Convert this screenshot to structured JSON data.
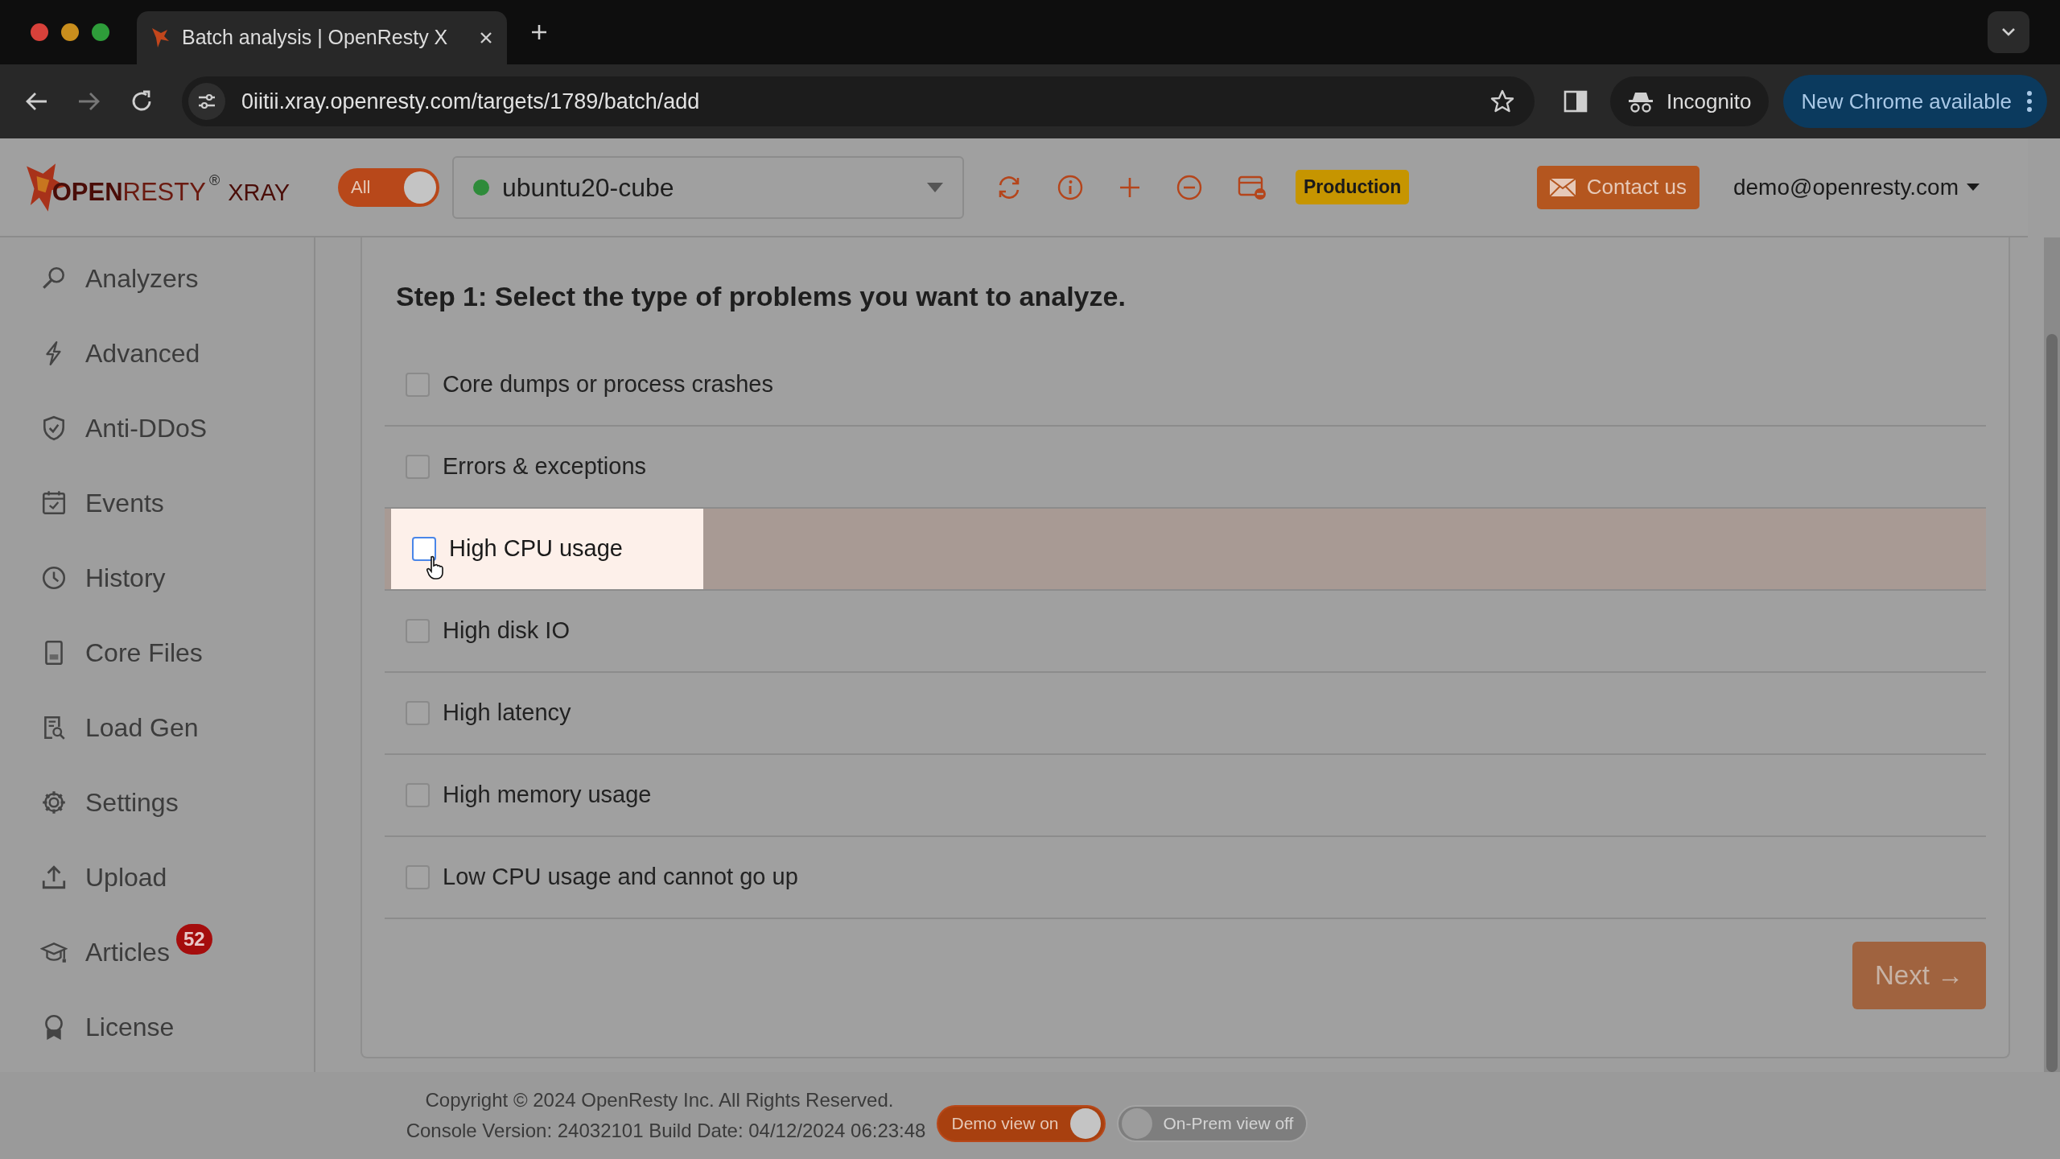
{
  "browser": {
    "tab_title": "Batch analysis | OpenResty X",
    "url": "0iitii.xray.openresty.com/targets/1789/batch/add",
    "incognito": "Incognito",
    "update": "New Chrome available"
  },
  "header": {
    "logo": {
      "brand_a": "OPEN",
      "brand_b": "RESTY",
      "mark": "®",
      "product": "XRAY"
    },
    "all_toggle": {
      "label": "All",
      "on": true
    },
    "target": {
      "value": "ubuntu20-cube",
      "color": "#2e8b3a"
    },
    "env_badge": "Production",
    "contact": "Contact us",
    "user": "demo@openresty.com"
  },
  "sidebar": {
    "items": [
      {
        "label": "Analyzers"
      },
      {
        "label": "Advanced"
      },
      {
        "label": "Anti-DDoS"
      },
      {
        "label": "Events"
      },
      {
        "label": "History"
      },
      {
        "label": "Core Files"
      },
      {
        "label": "Load Gen"
      },
      {
        "label": "Settings"
      },
      {
        "label": "Upload"
      },
      {
        "label": "Articles",
        "badge": "52"
      },
      {
        "label": "License"
      }
    ]
  },
  "step": {
    "title": "Step 1: Select the type of problems you want to analyze.",
    "options": [
      {
        "label": "Core dumps or process crashes",
        "checked": false,
        "highlighted": false
      },
      {
        "label": "Errors & exceptions",
        "checked": false,
        "highlighted": false
      },
      {
        "label": "High CPU usage",
        "checked": false,
        "highlighted": true
      },
      {
        "label": "High disk IO",
        "checked": false,
        "highlighted": false
      },
      {
        "label": "High latency",
        "checked": false,
        "highlighted": false
      },
      {
        "label": "High memory usage",
        "checked": false,
        "highlighted": false
      },
      {
        "label": "Low CPU usage and cannot go up",
        "checked": false,
        "highlighted": false
      }
    ],
    "next": "Next →"
  },
  "footer": {
    "copyright": "Copyright © 2024 OpenResty Inc. All Rights Reserved.",
    "version": "Console Version: 24032101 Build Date: 04/12/2024 06:23:48",
    "toggles": [
      {
        "label": "Demo view on",
        "on": true
      },
      {
        "label": "On-Prem view off",
        "on": false
      }
    ]
  }
}
